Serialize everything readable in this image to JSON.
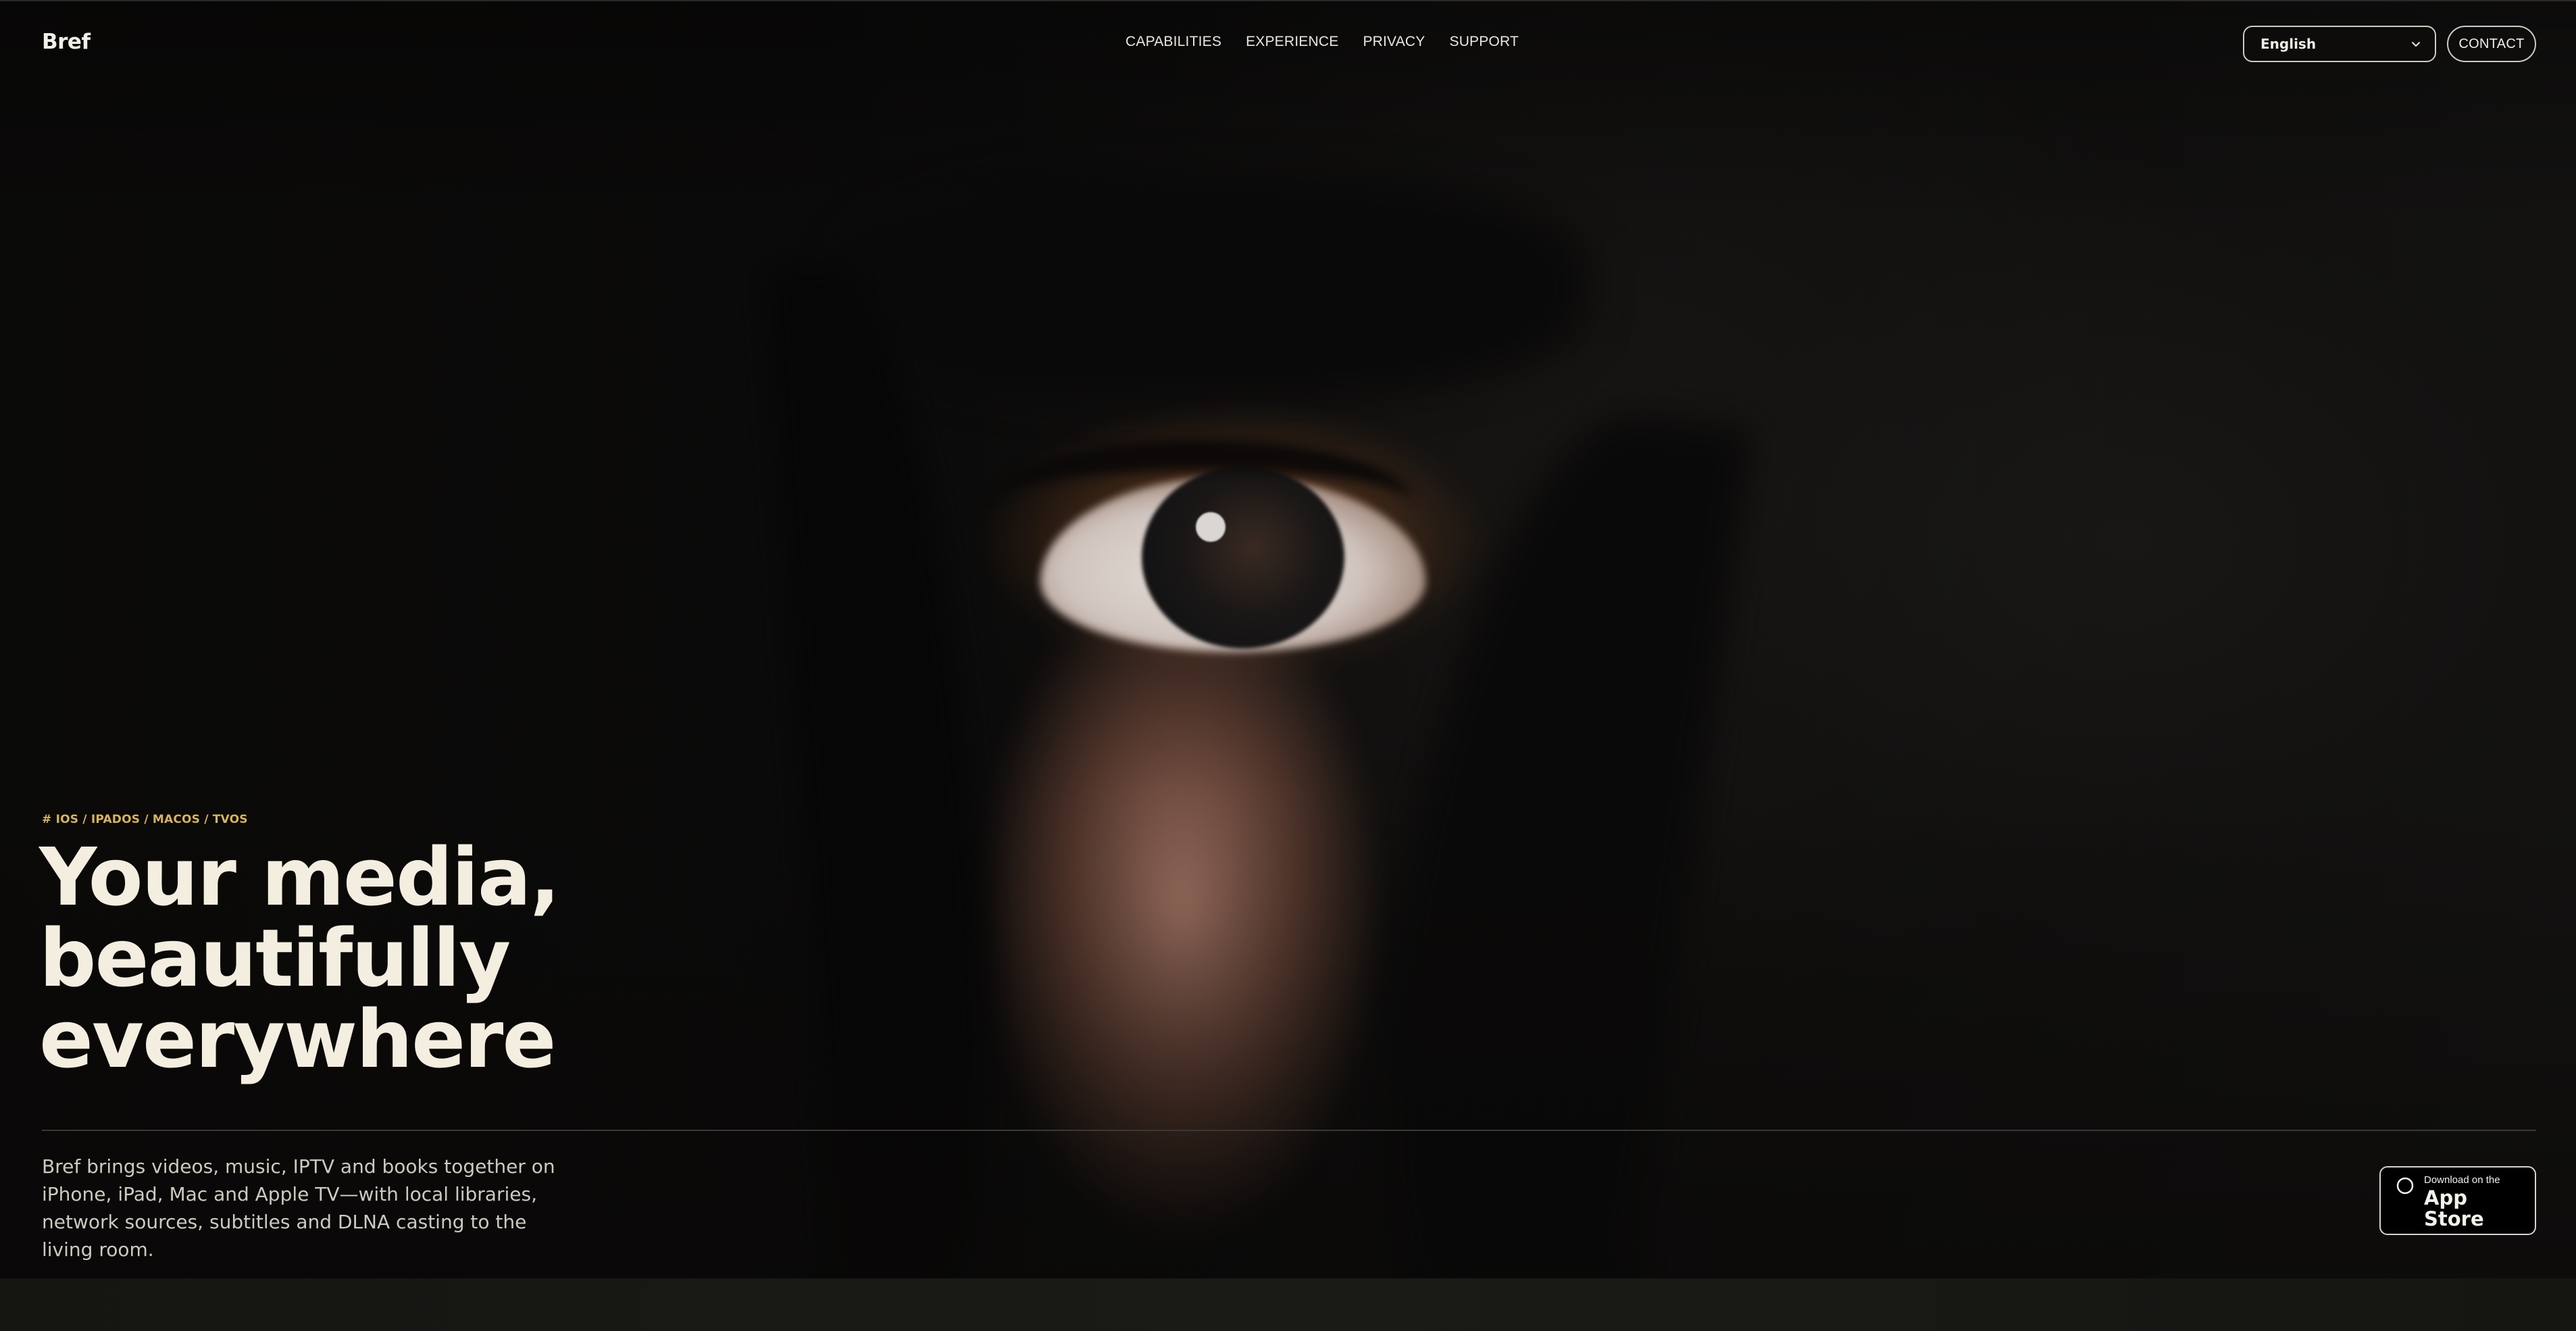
{
  "brand": {
    "name": "Bref"
  },
  "nav": {
    "items": [
      {
        "label": "CAPABILITIES"
      },
      {
        "label": "EXPERIENCE"
      },
      {
        "label": "PRIVACY"
      },
      {
        "label": "SUPPORT"
      }
    ]
  },
  "language": {
    "selected": "English"
  },
  "contact": {
    "label": "CONTACT"
  },
  "hero": {
    "platforms": "# IOS / IPADOS / MACOS / TVOS",
    "title_lines": [
      "Your media,",
      "beautifully",
      "everywhere"
    ],
    "description": "Bref brings videos, music, IPTV and books together on iPhone, iPad, Mac and Apple TV—with local libraries, network sources, subtitles and DLNA casting to the living room."
  },
  "app_store": {
    "small_text": "Download on the",
    "large_text": "App Store",
    "icon": "apple-icon"
  },
  "colors": {
    "accent": "#d8b45a",
    "text": "#f3eedf",
    "background": "#0d0c0b"
  }
}
